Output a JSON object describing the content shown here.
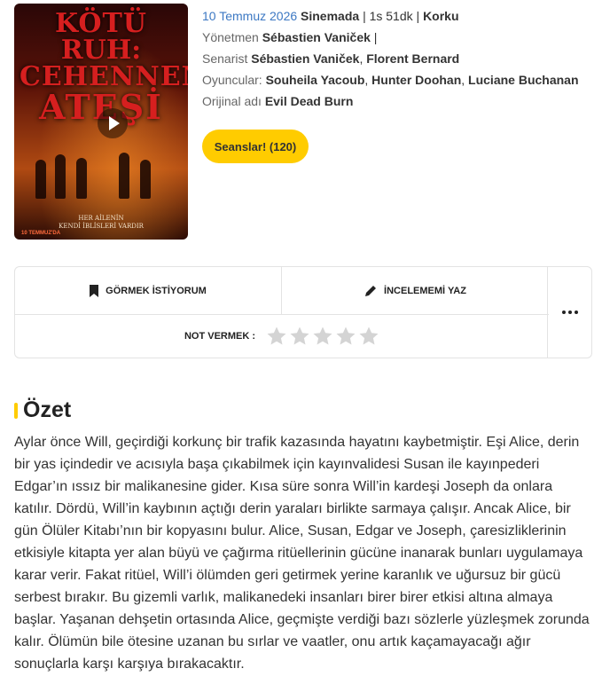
{
  "poster": {
    "title_line1": "KÖTÜ",
    "title_line2": "RUH:",
    "title_line3": "CEHENNEM",
    "title_line4": "ATEŞİ",
    "tagline_line1": "HER AİLENİN",
    "tagline_line2": "KENDİ İBLİSLERİ VARDIR",
    "date_text": "10 TEMMUZ'DA"
  },
  "info": {
    "release_date": "10 Temmuz 2026",
    "release_status": "Sinemada",
    "duration": "1s 51dk",
    "genre": "Korku",
    "separator": "|",
    "director_label": "Yönetmen",
    "director": "Sébastien Vaniček",
    "writer_label": "Senarist",
    "writers": [
      "Sébastien Vaniček",
      "Florent Bernard"
    ],
    "cast_label": "Oyuncular:",
    "cast": [
      "Souheila Yacoub",
      "Hunter Doohan",
      "Luciane Buchanan"
    ],
    "original_title_label": "Orijinal adı",
    "original_title": "Evil Dead Burn",
    "comma": ","
  },
  "seans_button": "Seanslar! (120)",
  "actions": {
    "watchlist": "GÖRMEK İSTİYORUM",
    "review": "İNCELEMEMİ YAZ",
    "rate_label": "NOT VERMEK :",
    "rating": 0,
    "max_rating": 5
  },
  "colors": {
    "accent": "#ffcc00",
    "link": "#3c78c3",
    "star_empty": "#d4d4d4"
  },
  "summary": {
    "title": "Özet",
    "text": "Aylar önce Will, geçirdiği korkunç bir trafik kazasında hayatını kaybetmiştir. Eşi Alice, derin bir yas içindedir ve acısıyla başa çıkabilmek için kayınvalidesi Susan ile kayınpederi Edgar’ın ıssız bir malikanesine gider. Kısa süre sonra Will’in kardeşi Joseph da onlara katılır. Dördü, Will’in kaybının açtığı derin yaraları birlikte sarmaya çalışır. Ancak Alice, bir gün Ölüler Kitabı’nın bir kopyasını bulur. Alice, Susan, Edgar ve Joseph, çaresizliklerinin etkisiyle kitapta yer alan büyü ve çağırma ritüellerinin gücüne inanarak bunları uygulamaya karar verir. Fakat ritüel, Will’i ölümden geri getirmek yerine karanlık ve uğursuz bir gücü serbest bırakır. Bu gizemli varlık, malikanedeki insanları birer birer etkisi altına almaya başlar. Yaşanan dehşetin ortasında Alice, geçmişte verdiği bazı sözlerle yüzleşmek zorunda kalır. Ölümün bile ötesine uzanan bu sırlar ve vaatler, onu artık kaçamayacağı ağır sonuçlarla karşı karşıya bırakacaktır."
  }
}
